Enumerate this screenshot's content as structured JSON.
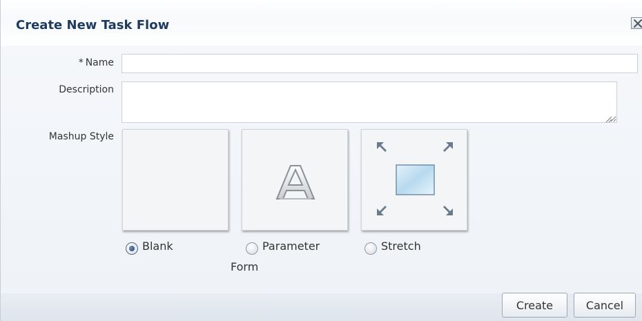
{
  "dialog": {
    "title": "Create New Task Flow"
  },
  "form": {
    "name_required_marker": "*",
    "name_label": "Name",
    "name_value": "",
    "description_label": "Description",
    "description_value": "",
    "mashup_style_label": "Mashup Style"
  },
  "mashup_styles": [
    {
      "label": "Blank",
      "icon": "blank-layout-icon",
      "selected": true
    },
    {
      "label": "Parameter Form",
      "label_line1": "Parameter",
      "label_line2": "Form",
      "icon": "parameter-form-icon",
      "selected": false
    },
    {
      "label": "Stretch",
      "icon": "stretch-layout-icon",
      "selected": false
    }
  ],
  "buttons": {
    "create": "Create",
    "cancel": "Cancel"
  },
  "icons": {
    "close": "close-icon"
  },
  "colors": {
    "title": "#1f3a5f",
    "radio_selected": "#1e3e6c"
  }
}
